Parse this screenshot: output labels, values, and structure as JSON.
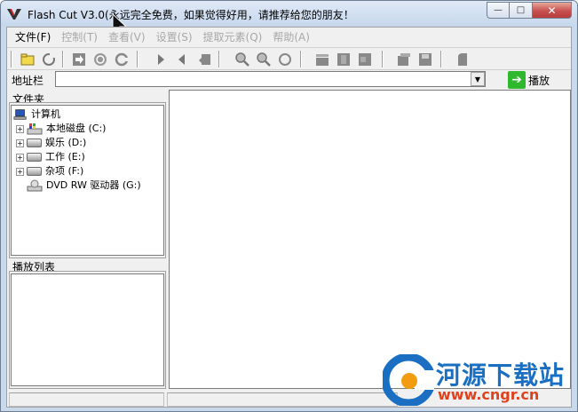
{
  "window": {
    "title": "Flash Cut   V3.0(永远完全免费，如果觉得好用，请推荐给您的朋友！",
    "minimize_label": "—",
    "maximize_label": "□",
    "close_label": "✕"
  },
  "menu": {
    "items": [
      {
        "label": "文件(F)",
        "enabled": true
      },
      {
        "label": "控制(T)",
        "enabled": false
      },
      {
        "label": "查看(V)",
        "enabled": false
      },
      {
        "label": "设置(S)",
        "enabled": false
      },
      {
        "label": "提取元素(Q)",
        "enabled": false
      },
      {
        "label": "帮助(A)",
        "enabled": false
      }
    ]
  },
  "toolbar": {
    "icons": [
      "open-folder-icon",
      "refresh-icon",
      "go-icon",
      "stop-icon",
      "loop-icon",
      "play-icon",
      "back-icon",
      "export-icon",
      "zoom-in-icon",
      "zoom-out-icon",
      "zoom-reset-icon",
      "clapper-icon",
      "frame-prev-icon",
      "frame-next-icon",
      "properties-icon",
      "save-icon",
      "extract-icon"
    ]
  },
  "address": {
    "label": "地址栏",
    "value": "",
    "play_label": "播放"
  },
  "folders": {
    "caption": "文件夹",
    "root": "计算机",
    "drives": [
      {
        "label": "本地磁盘 (C:)",
        "expandable": true,
        "icon": "system-drive-icon"
      },
      {
        "label": "娱乐 (D:)",
        "expandable": true,
        "icon": "hard-drive-icon"
      },
      {
        "label": "工作 (E:)",
        "expandable": true,
        "icon": "hard-drive-icon"
      },
      {
        "label": "杂项 (F:)",
        "expandable": true,
        "icon": "hard-drive-icon"
      },
      {
        "label": "DVD RW 驱动器 (G:)",
        "expandable": false,
        "icon": "dvd-drive-icon"
      }
    ]
  },
  "playlist": {
    "caption": "播放列表"
  },
  "watermark": {
    "name": "河源下载站",
    "url": "www.cngr.cn"
  },
  "colors": {
    "accent_green": "#2eb82e",
    "watermark_blue": "#1a6fc2",
    "watermark_red": "#e0421e"
  }
}
